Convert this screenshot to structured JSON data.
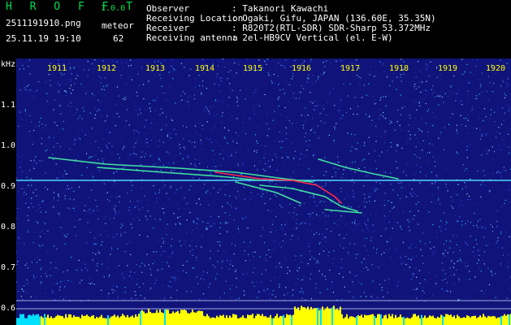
{
  "header": {
    "brand": "H R O F F T",
    "version": "1.0.0",
    "filename": "2511191910.png",
    "datetime": "25.11.19 19:10",
    "meteor_label": "meteor",
    "meteor_count": "62",
    "info": [
      {
        "key": "Observer",
        "value": ": Takanori Kawachi"
      },
      {
        "key": "Receiving Location",
        "value": ": Ogaki, Gifu, JAPAN (136.60E, 35.35N)"
      },
      {
        "key": "Receiver",
        "value": ": R820T2(RTL-SDR) SDR-Sharp 53.372MHz"
      },
      {
        "key": "Receiving antenna",
        "value": ": 2el-HB9CV Vertical (el. E-W)"
      }
    ]
  },
  "y_axis": {
    "unit": "kHz",
    "ticks": [
      "1.1",
      "1.0",
      "0.9",
      "0.8",
      "0.7",
      "0.6"
    ]
  },
  "x_axis": {
    "ticks": [
      "1911",
      "1912",
      "1913",
      "1914",
      "1915",
      "1916",
      "1917",
      "1918",
      "1919",
      "1920"
    ]
  },
  "colors": {
    "background": "#10147a",
    "carrier": "#4fd8ff",
    "echo": "#40e0a0",
    "echo_hot": "#ff2a4a",
    "level": "#ffff00",
    "level_alt": "#00e0ff"
  }
}
